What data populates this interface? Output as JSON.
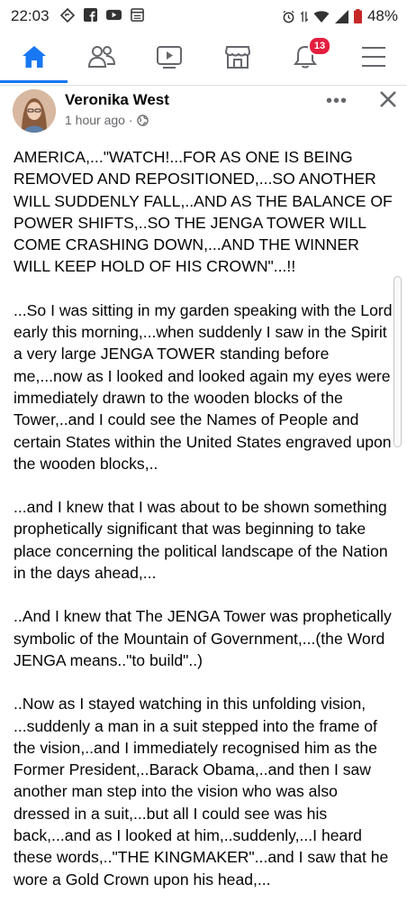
{
  "status_bar": {
    "time": "22:03",
    "battery": "48%"
  },
  "nav": {
    "notification_count": "13",
    "items": [
      {
        "icon": "home-icon"
      },
      {
        "icon": "friends-icon"
      },
      {
        "icon": "watch-icon"
      },
      {
        "icon": "marketplace-icon"
      },
      {
        "icon": "notifications-icon"
      },
      {
        "icon": "menu-icon"
      }
    ],
    "accent_color": "#1877f2"
  },
  "post": {
    "author": "Veronika West",
    "timestamp": "1 hour ago ·",
    "more_label": "•••",
    "paragraphs": [
      "AMERICA,...\"WATCH!...FOR AS ONE IS BEING REMOVED AND REPOSITIONED,...SO ANOTHER WILL SUDDENLY FALL,..AND AS THE BALANCE OF POWER SHIFTS,..SO THE JENGA TOWER WILL COME CRASHING DOWN,...AND THE WINNER WILL KEEP HOLD OF HIS CROWN\"...!!",
      "...So I was sitting in my garden speaking with the Lord early this morning,...when suddenly I saw in the Spirit a very large JENGA TOWER standing before me,...now as I looked and looked again my eyes were immediately drawn to the wooden blocks of the Tower,..and I could see the Names of People and certain States within the United States engraved upon the wooden blocks,..",
      "...and I knew that I was about to be shown something prophetically significant that was beginning to take place concerning the political landscape of the Nation in the days ahead,...",
      "..And I knew that The JENGA Tower was prophetically symbolic of the Mountain of Government,...(the Word JENGA means..\"to build\"..)",
      "..Now as I stayed watching in this unfolding vision, ...suddenly a man in a suit stepped into the frame of the vision,..and I immediately recognised him as the Former President,..Barack Obama,..and then I saw another man step into the vision who was also dressed in a suit,...but all I could see was his back,...and as I looked at him,..suddenly,...I heard these words,..\"THE KINGMAKER\"...and I saw that he wore a Gold Crown upon his head,..."
    ]
  }
}
